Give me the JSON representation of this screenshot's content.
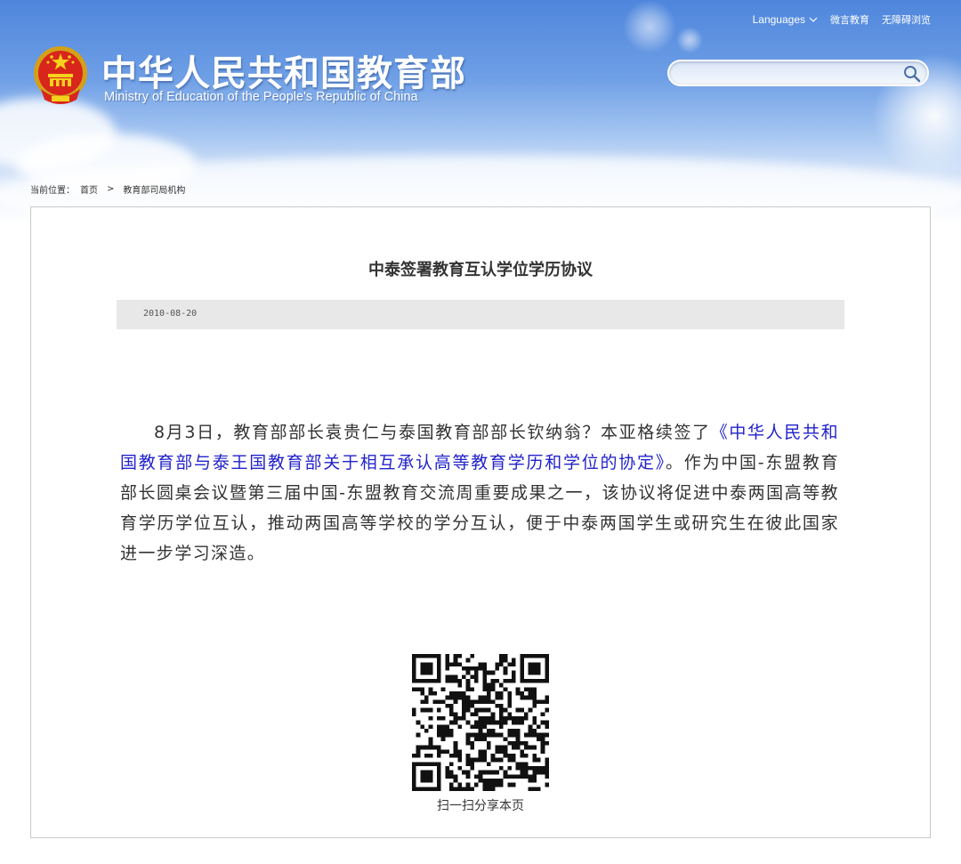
{
  "header": {
    "site_title_cn": "中华人民共和国教育部",
    "site_title_en": "Ministry of Education of the People's Republic of China",
    "top_links": {
      "languages": "Languages",
      "edu_tv": "微言教育",
      "accessibility": "无障碍浏览"
    },
    "search": {
      "placeholder": "",
      "value": ""
    }
  },
  "breadcrumb": {
    "prefix": "当前位置：",
    "items": [
      "首页",
      "教育部司局机构"
    ],
    "separator": ">"
  },
  "article": {
    "title": "中泰签署教育互认学位学历协议",
    "date": "2010-08-20",
    "body_before_link": "8月3日，教育部部长袁贵仁与泰国教育部部长钦纳翁？本亚格续签了",
    "body_link": "《中华人民共和国教育部与泰王国教育部关于相互承认高等教育学历和学位的协定》",
    "body_after_link": "。作为中国-东盟教育部长圆桌会议暨第三届中国-东盟教育交流周重要成果之一，该协议将促进中泰两国高等教育学历学位互认，推动两国高等学校的学分互认，便于中泰两国学生或研究生在彼此国家进一步学习深造。"
  },
  "qr": {
    "caption": "扫一扫分享本页",
    "icon": "qr-code"
  },
  "colors": {
    "header_blue": "#4f86dc",
    "link_blue": "#2222cc",
    "text": "#333333",
    "date_bar": "#e8e8e8"
  }
}
